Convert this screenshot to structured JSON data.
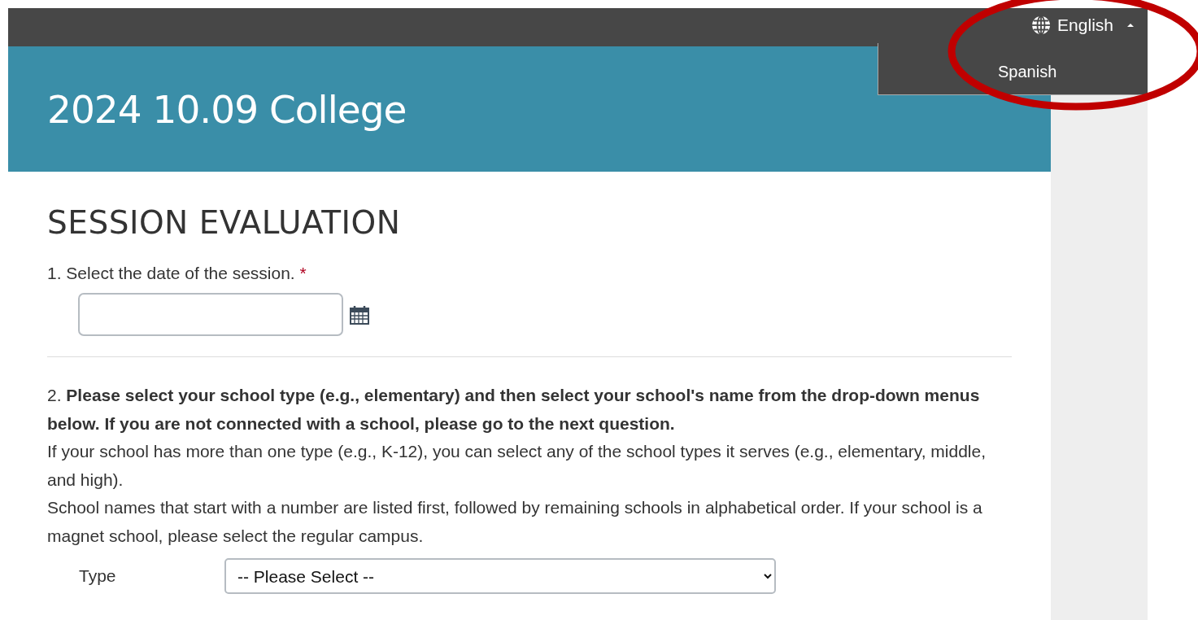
{
  "language_menu": {
    "current": "English",
    "expanded": true,
    "options": [
      {
        "label": "Spanish",
        "selected": false
      }
    ]
  },
  "header": {
    "title": "2024 10.09 College"
  },
  "section_title": "SESSION EVALUATION",
  "questions": [
    {
      "kind": "date",
      "label": "1. Select the date of the session.",
      "required_mark": "*"
    },
    {
      "kind": "select",
      "prompt": "2. **Please select your school type (e.g., elementary) and then select your school's name from the drop-down menus below. If you are not connected with a school, please go to the next question.**",
      "notes": [
        "If your school has more than one type (e.g., K-12), you can select any of the school types it serves (e.g., elementary, middle, and high).",
        "School names that start with a number are listed first, followed by remaining schools in alphabetical order. If your school is a magnet school, please select the regular campus."
      ],
      "fields": [
        {
          "label": "Type",
          "value": "-- Please Select --"
        }
      ]
    }
  ]
}
